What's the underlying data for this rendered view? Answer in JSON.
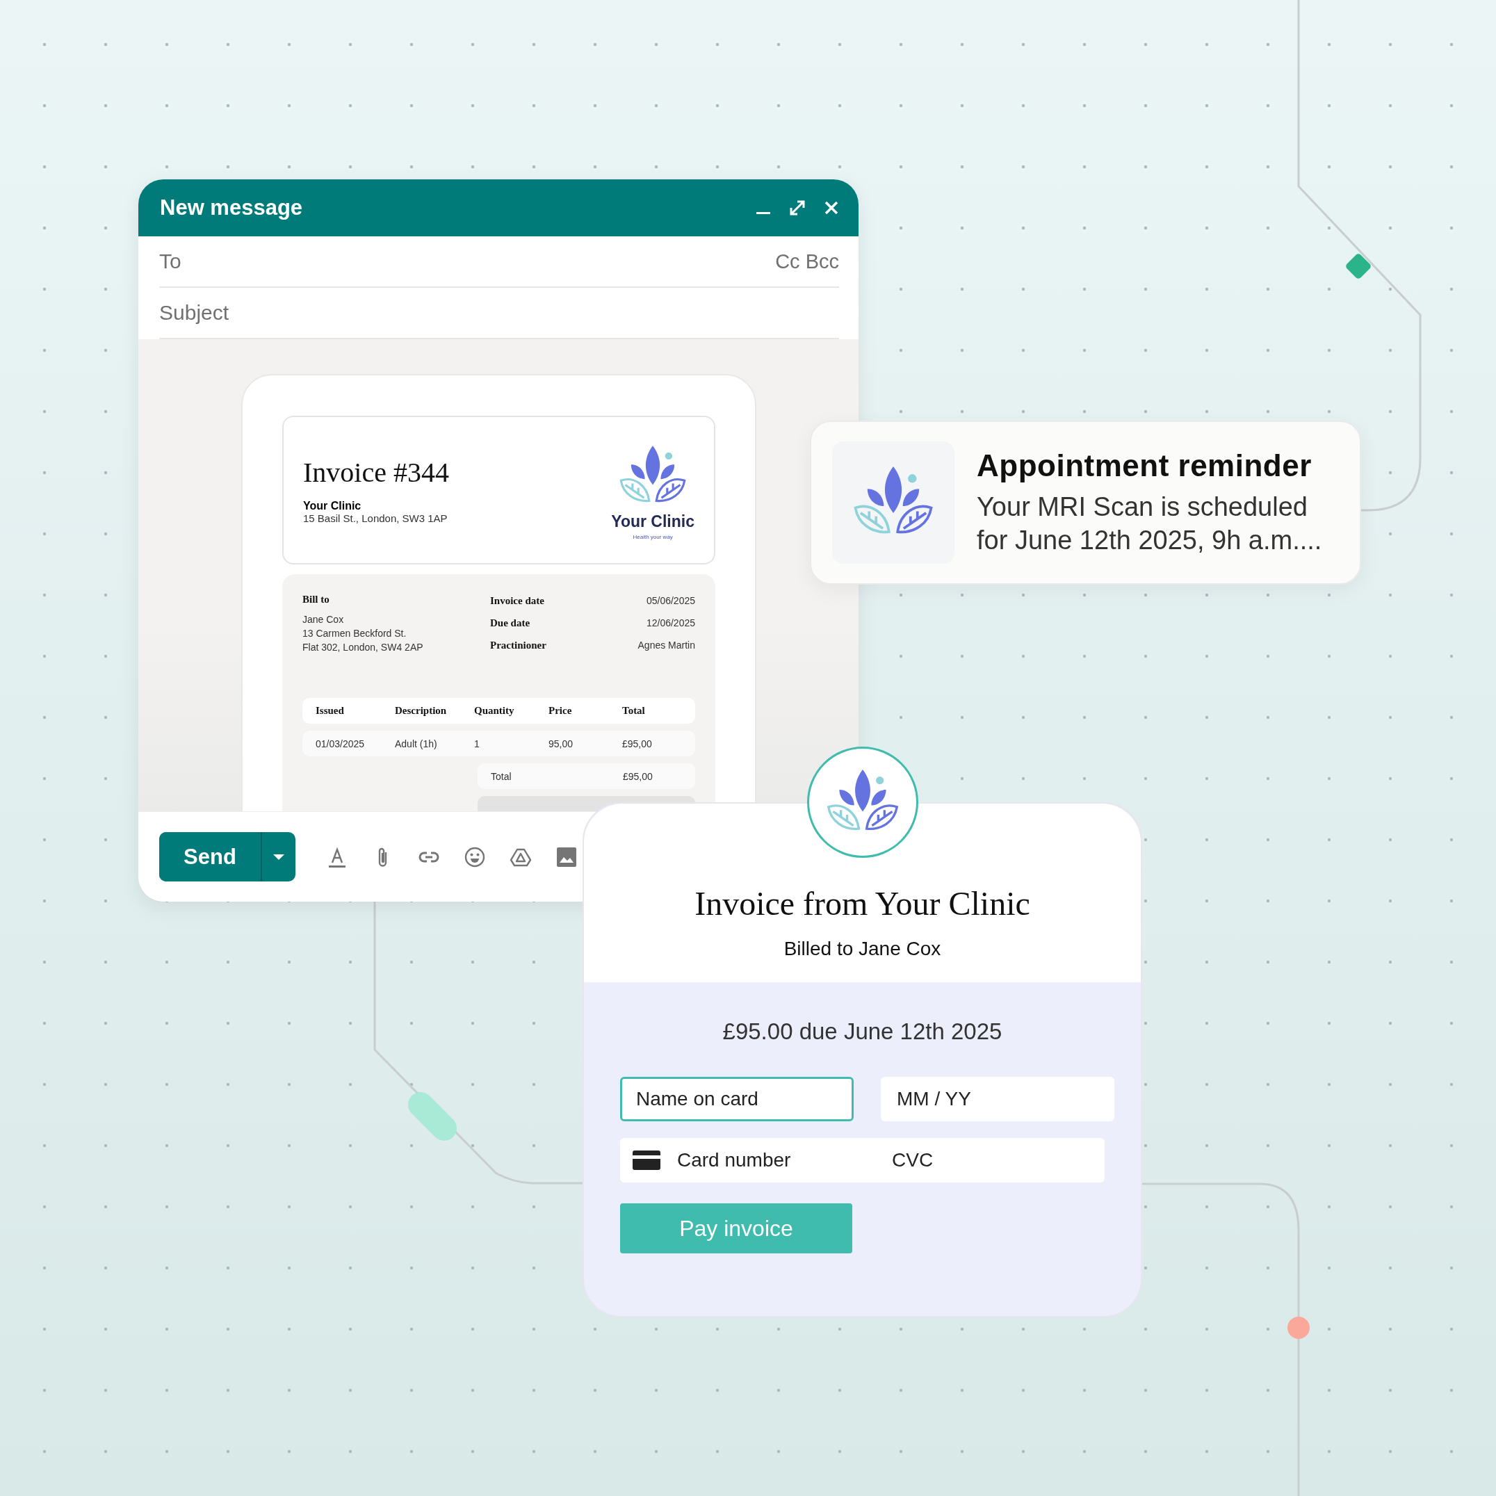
{
  "compose": {
    "title": "New message",
    "to_placeholder": "To",
    "cc_bcc": "Cc Bcc",
    "subject_placeholder": "Subject",
    "invoice": {
      "title": "Invoice #344",
      "clinic_name": "Your Clinic",
      "clinic_address": "15 Basil St., London, SW3 1AP",
      "logo_name": "Your Clinic",
      "logo_tagline": "Health your way",
      "bill_to_label": "Bill to",
      "bill_to_lines": [
        "Jane Cox",
        "13 Carmen Beckford St.",
        "Flat 302, London, SW4 2AP"
      ],
      "details": [
        {
          "label": "Invoice date",
          "value": "05/06/2025"
        },
        {
          "label": "Due date",
          "value": "12/06/2025"
        },
        {
          "label": "Practinioner",
          "value": "Agnes Martin"
        }
      ],
      "table": {
        "columns": [
          "Issued",
          "Description",
          "Quantity",
          "Price",
          "Total"
        ],
        "rows": [
          [
            "01/03/2025",
            "Adult (1h)",
            "1",
            "95,00",
            "£95,00"
          ]
        ]
      },
      "total_label": "Total",
      "total_value": "£95,00"
    },
    "send_label": "Send"
  },
  "reminder": {
    "title": "Appointment reminder",
    "body": "Your MRI Scan is scheduled for June 12th 2025, 9h a.m...."
  },
  "payment": {
    "title": "Invoice from Your Clinic",
    "billed_to": "Billed to Jane Cox",
    "amount_due": "£95.00 due June 12th 2025",
    "fields": [
      {
        "placeholder": "Name on card",
        "focused": true
      },
      {
        "placeholder": "MM / YY",
        "focused": false
      }
    ],
    "card_number_placeholder": "Card number",
    "cvc_placeholder": "CVC",
    "pay_button": "Pay invoice"
  }
}
